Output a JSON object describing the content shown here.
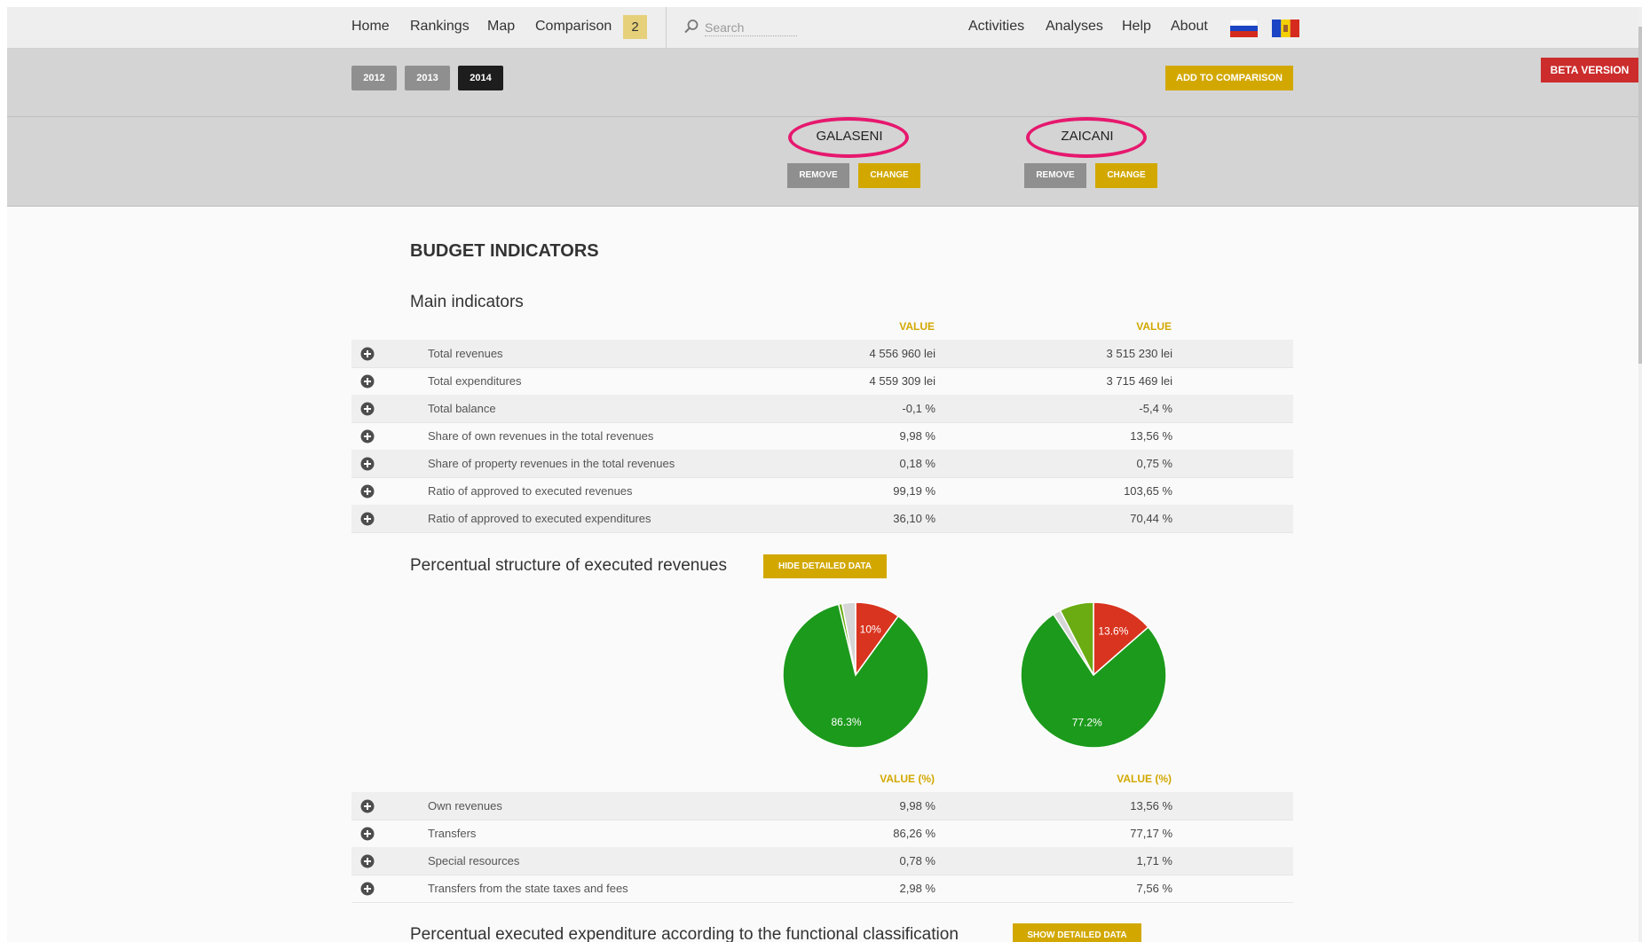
{
  "nav": {
    "home": "Home",
    "rankings": "Rankings",
    "map": "Map",
    "comparison": "Comparison",
    "comparison_count": "2",
    "search_placeholder": "Search",
    "activities": "Activities",
    "analyses": "Analyses",
    "help": "Help",
    "about": "About"
  },
  "years": [
    "2012",
    "2013",
    "2014"
  ],
  "selected_year": "2014",
  "add_to_comparison": "ADD TO COMPARISON",
  "beta_label": "BETA VERSION",
  "entities": [
    {
      "name": "GALASENI",
      "remove": "REMOVE",
      "change": "CHANGE"
    },
    {
      "name": "ZAICANI",
      "remove": "REMOVE",
      "change": "CHANGE"
    }
  ],
  "budget": {
    "title": "BUDGET INDICATORS",
    "main_title": "Main indicators",
    "value_header": "VALUE",
    "main_rows": [
      {
        "label": "Total revenues",
        "v1": "4 556 960 lei",
        "v2": "3 515 230 lei"
      },
      {
        "label": "Total expenditures",
        "v1": "4 559 309 lei",
        "v2": "3 715 469 lei"
      },
      {
        "label": "Total balance",
        "v1": "-0,1 %",
        "v2": "-5,4 %"
      },
      {
        "label": "Share of own revenues in the total revenues",
        "v1": "9,98 %",
        "v2": "13,56 %"
      },
      {
        "label": "Share of property revenues in the total revenues",
        "v1": "0,18 %",
        "v2": "0,75 %"
      },
      {
        "label": "Ratio of approved to executed revenues",
        "v1": "99,19 %",
        "v2": "103,65 %"
      },
      {
        "label": "Ratio of approved to executed expenditures",
        "v1": "36,10 %",
        "v2": "70,44 %"
      }
    ],
    "revenue_structure_title": "Percentual structure of executed revenues",
    "hide_detailed": "HIDE DETAILED DATA",
    "value_pct_header": "VALUE (%)",
    "revenue_rows": [
      {
        "label": "Own revenues",
        "v1": "9,98 %",
        "v2": "13,56 %"
      },
      {
        "label": "Transfers",
        "v1": "86,26 %",
        "v2": "77,17 %"
      },
      {
        "label": "Special resources",
        "v1": "0,78 %",
        "v2": "1,71 %"
      },
      {
        "label": "Transfers from the state taxes and fees",
        "v1": "2,98 %",
        "v2": "7,56 %"
      }
    ],
    "expenditure_title": "Percentual executed expenditure according to the functional classification",
    "show_detailed": "SHOW DETAILED DATA"
  },
  "colors": {
    "accent": "#d2a800",
    "beta": "#cc2c2c",
    "highlight_ring": "#e6186e",
    "pie_red": "#d9341f",
    "pie_green": "#1c9a1c",
    "pie_lightgreen": "#6aac12",
    "pie_grey": "#d6d6d6"
  },
  "chart_data": [
    {
      "type": "pie",
      "title": "",
      "categories": [
        "Own revenues",
        "Transfers",
        "Special resources",
        "Transfers from the state taxes and fees"
      ],
      "values": [
        9.98,
        86.26,
        0.78,
        2.98
      ],
      "slice_labels": [
        "10%",
        "86.3%",
        "",
        ""
      ],
      "colors": [
        "#d9341f",
        "#1c9a1c",
        "#6aac12",
        "#d6d6d6"
      ]
    },
    {
      "type": "pie",
      "title": "",
      "categories": [
        "Own revenues",
        "Transfers",
        "Special resources",
        "Transfers from the state taxes and fees"
      ],
      "values": [
        13.56,
        77.17,
        1.71,
        7.56
      ],
      "slice_labels": [
        "13.6%",
        "77.2%",
        "",
        ""
      ],
      "colors": [
        "#d9341f",
        "#1c9a1c",
        "#d6d6d6",
        "#6aac12"
      ]
    }
  ]
}
